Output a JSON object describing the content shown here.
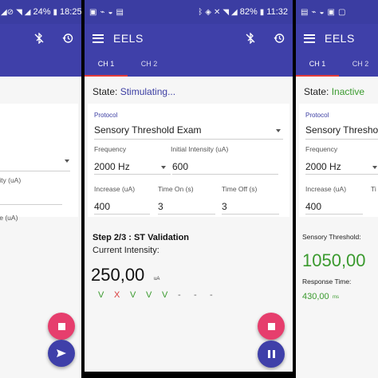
{
  "left": {
    "status": {
      "battery": "24%",
      "time": "18:25"
    },
    "fields": {
      "intensity_label_partial": "sity (uA)",
      "increase_label_partial": "se (uA)"
    }
  },
  "center": {
    "status": {
      "battery": "82%",
      "time": "11:32"
    },
    "app_title": "EELS",
    "tabs": [
      "CH 1",
      "CH 2"
    ],
    "state_label": "State:",
    "state_value": "Stimulating...",
    "protocol_label": "Protocol",
    "protocol_value": "Sensory Threshold Exam",
    "frequency_label": "Frequency",
    "frequency_value": "2000 Hz",
    "initial_intensity_label": "Initial Intensity (uA)",
    "initial_intensity_value": "600",
    "increase_label": "Increase (uA)",
    "increase_value": "400",
    "time_on_label": "Time On (s)",
    "time_on_value": "3",
    "time_off_label": "Time Off (s)",
    "time_off_value": "3",
    "step_text": "Step 2/3 : ST Validation",
    "current_intensity_label": "Current Intensity:",
    "current_intensity_value": "250,00",
    "current_intensity_unit": "uA",
    "response_marks": [
      "V",
      "X",
      "V",
      "V",
      "V",
      "-",
      "-",
      "-"
    ]
  },
  "right": {
    "app_title": "EELS",
    "tabs": [
      "CH 1",
      "CH 2"
    ],
    "state_label": "State:",
    "state_value": "Inactive",
    "protocol_label": "Protocol",
    "protocol_value": "Sensory Threshol",
    "frequency_label": "Frequency",
    "frequency_value": "2000 Hz",
    "increase_label": "Increase (uA)",
    "increase_value": "400",
    "time_partial_label": "Ti",
    "sensory_threshold_label": "Sensory Threshold:",
    "sensory_threshold_value": "1050,00",
    "response_time_label": "Response Time:",
    "response_time_value": "430,00",
    "response_time_unit": "ms"
  },
  "colors": {
    "primary": "#3f40a9",
    "accent_stop": "#e63e6d",
    "success": "#3a9a2e",
    "error": "#d93a3a"
  }
}
